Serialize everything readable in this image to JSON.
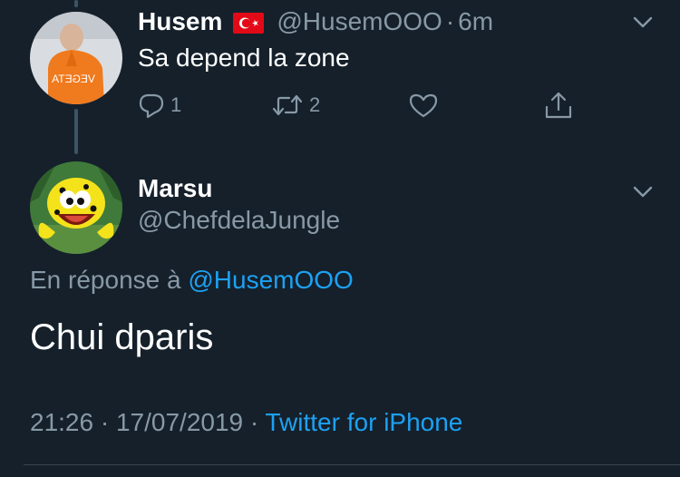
{
  "reply_tweet": {
    "name": "Husem",
    "flag_icon": "turkey-flag-icon",
    "handle": "@HusemOOO",
    "separator": "·",
    "time": "6m",
    "text": "Sa depend la zone",
    "avatar_shirt_text": "VEGETA",
    "actions": {
      "reply_count": "1",
      "retweet_count": "2"
    }
  },
  "focused_tweet": {
    "name": "Marsu",
    "handle": "@ChefdelaJungle",
    "reply_prefix": "En réponse à",
    "reply_mention": "@HusemOOO",
    "text": "Chui dparis",
    "time": "21:26",
    "separator1": "·",
    "date": "17/07/2019",
    "separator2": "·",
    "source": "Twitter for iPhone"
  },
  "colors": {
    "background": "#15202b",
    "primary_text": "#ffffff",
    "secondary_text": "#8899a6",
    "accent": "#1da1f2",
    "thread_line": "#3d5466",
    "divider": "#38444d"
  }
}
